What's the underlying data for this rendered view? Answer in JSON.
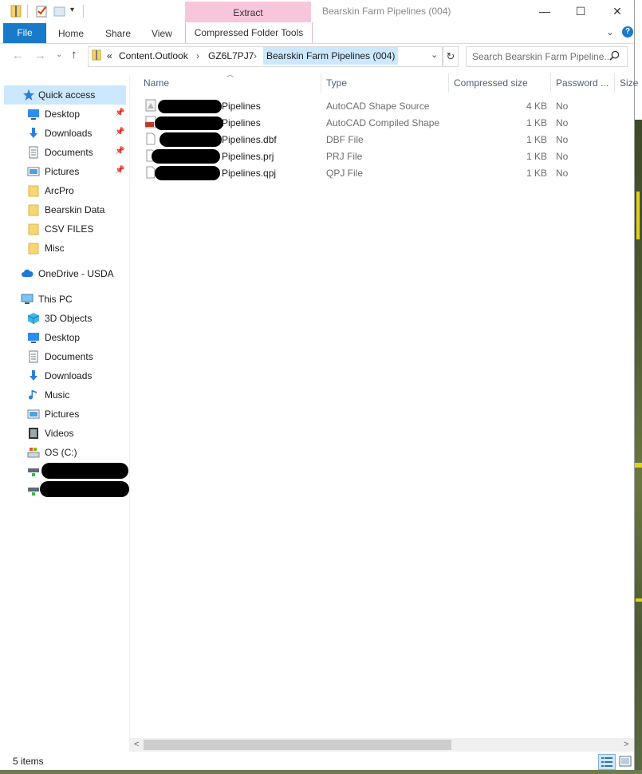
{
  "window": {
    "title": "Bearskin Farm Pipelines (004)",
    "contextual_tab_group": "Extract",
    "minimize": "—",
    "maximize": "☐",
    "close": "✕"
  },
  "ribbon": {
    "tabs": [
      "File",
      "Home",
      "Share",
      "View",
      "Compressed Folder Tools"
    ]
  },
  "address": {
    "overflow": "«",
    "crumbs": [
      "Content.Outlook",
      "GZ6L7PJ7",
      "Bearskin Farm Pipelines (004)"
    ],
    "separator": "›",
    "search_placeholder": "Search Bearskin Farm Pipeline..."
  },
  "nav": {
    "quick_access": "Quick access",
    "quick_items": [
      {
        "label": "Desktop",
        "icon": "desktop-icon",
        "pinned": true
      },
      {
        "label": "Downloads",
        "icon": "downloads-icon",
        "pinned": true
      },
      {
        "label": "Documents",
        "icon": "documents-icon",
        "pinned": true
      },
      {
        "label": "Pictures",
        "icon": "pictures-icon",
        "pinned": true
      },
      {
        "label": "ArcPro",
        "icon": "folder-icon",
        "pinned": false
      },
      {
        "label": "Bearskin Data",
        "icon": "folder-icon",
        "pinned": false
      },
      {
        "label": "CSV FILES",
        "icon": "folder-icon",
        "pinned": false
      },
      {
        "label": "Misc",
        "icon": "folder-icon",
        "pinned": false
      }
    ],
    "onedrive": "OneDrive - USDA",
    "this_pc": "This PC",
    "pc_items": [
      {
        "label": "3D Objects",
        "icon": "3d-objects-icon"
      },
      {
        "label": "Desktop",
        "icon": "desktop-icon"
      },
      {
        "label": "Documents",
        "icon": "documents-icon"
      },
      {
        "label": "Downloads",
        "icon": "downloads-icon"
      },
      {
        "label": "Music",
        "icon": "music-icon"
      },
      {
        "label": "Pictures",
        "icon": "pictures-icon"
      },
      {
        "label": "Videos",
        "icon": "videos-icon"
      },
      {
        "label": "OS (C:)",
        "icon": "drive-icon"
      }
    ]
  },
  "columns": {
    "name": "Name",
    "type": "Type",
    "compressed_size": "Compressed size",
    "password": "Password ...",
    "size": "Size"
  },
  "files": [
    {
      "name": "Pipelines",
      "type": "AutoCAD Shape Source",
      "compressed_size": "4 KB",
      "password": "No",
      "icon": "shape-source-icon"
    },
    {
      "name": "Pipelines",
      "type": "AutoCAD Compiled Shape",
      "compressed_size": "1 KB",
      "password": "No",
      "icon": "compiled-shape-icon"
    },
    {
      "name": "Pipelines.dbf",
      "type": "DBF File",
      "compressed_size": "1 KB",
      "password": "No",
      "icon": "file-icon"
    },
    {
      "name": "Pipelines.prj",
      "type": "PRJ File",
      "compressed_size": "1 KB",
      "password": "No",
      "icon": "file-icon"
    },
    {
      "name": "Pipelines.qpj",
      "type": "QPJ File",
      "compressed_size": "1 KB",
      "password": "No",
      "icon": "file-icon"
    }
  ],
  "status": {
    "items": "5 items"
  },
  "colors": {
    "accent": "#1979ca",
    "selection": "#cce8ff",
    "contextual_tab": "#f7c6dc"
  }
}
